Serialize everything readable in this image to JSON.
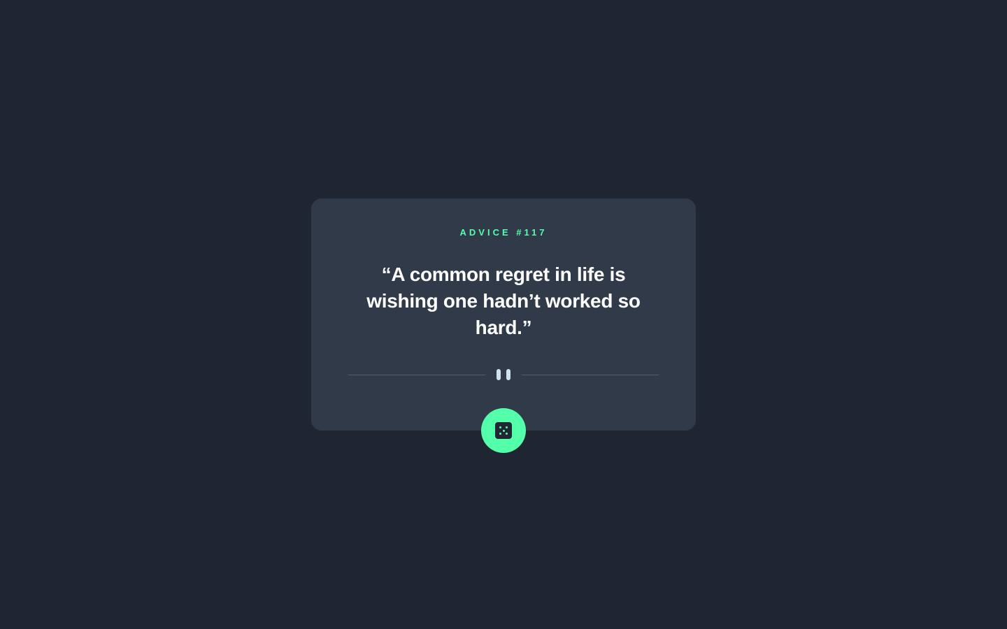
{
  "advice": {
    "label": "ADVICE #117",
    "quote": "“A common regret in life is wishing one hadn’t worked so hard.”"
  },
  "icons": {
    "divider": "pause-icon",
    "button": "dice-icon"
  },
  "colors": {
    "background": "#1f2632",
    "card": "#313a49",
    "accent": "#53ffaa",
    "text": "#ffffff",
    "divider": "#4f5d74"
  }
}
